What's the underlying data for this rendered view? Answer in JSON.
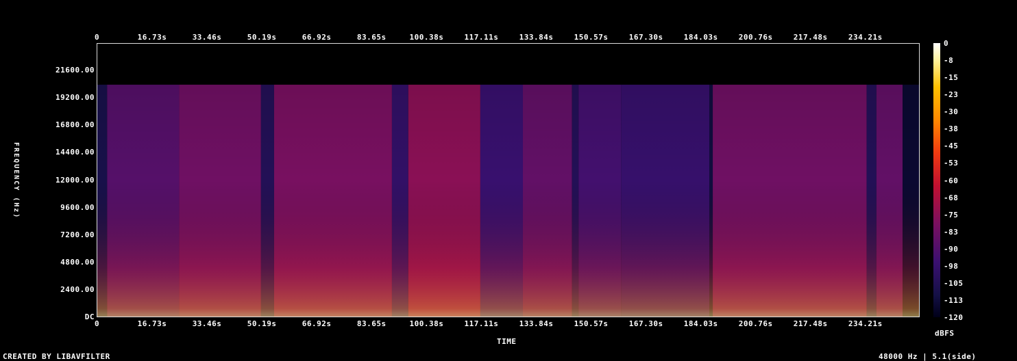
{
  "chart_data": {
    "type": "heatmap",
    "title": "",
    "xlabel": "TIME",
    "ylabel": "FREQUENCY (Hz)",
    "x_ticks": [
      "0",
      "16.73s",
      "33.46s",
      "50.19s",
      "66.92s",
      "83.65s",
      "100.38s",
      "117.11s",
      "133.84s",
      "150.57s",
      "167.30s",
      "184.03s",
      "200.76s",
      "217.48s",
      "234.21s"
    ],
    "x_tick_values": [
      0,
      16.73,
      33.46,
      50.19,
      66.92,
      83.65,
      100.38,
      117.11,
      133.84,
      150.57,
      167.3,
      184.03,
      200.76,
      217.48,
      234.21
    ],
    "xlim": [
      0,
      251
    ],
    "y_ticks": [
      "DC",
      "2400.00",
      "4800.00",
      "7200.00",
      "9600.00",
      "12000.00",
      "14400.00",
      "16800.00",
      "19200.00",
      "21600.00"
    ],
    "y_tick_values": [
      0,
      2400,
      4800,
      7200,
      9600,
      12000,
      14400,
      16800,
      19200,
      21600
    ],
    "ylim": [
      0,
      24000
    ],
    "colorbar": {
      "label": "dBFS",
      "ticks": [
        "0",
        "-8",
        "-15",
        "-23",
        "-30",
        "-38",
        "-45",
        "-53",
        "-60",
        "-68",
        "-75",
        "-83",
        "-90",
        "-98",
        "-105",
        "-113",
        "-120"
      ],
      "range": [
        -120,
        0
      ]
    },
    "content_cutoff_hz": 20400,
    "segments": [
      {
        "t0": 0,
        "t1": 3,
        "level": -100
      },
      {
        "t0": 3,
        "t1": 25,
        "level": -78
      },
      {
        "t0": 25,
        "t1": 50,
        "level": -72
      },
      {
        "t0": 50,
        "t1": 54,
        "level": -95
      },
      {
        "t0": 54,
        "t1": 90,
        "level": -70
      },
      {
        "t0": 90,
        "t1": 95,
        "level": -88
      },
      {
        "t0": 95,
        "t1": 117,
        "level": -66
      },
      {
        "t0": 117,
        "t1": 130,
        "level": -85
      },
      {
        "t0": 130,
        "t1": 145,
        "level": -75
      },
      {
        "t0": 145,
        "t1": 147,
        "level": -95
      },
      {
        "t0": 147,
        "t1": 160,
        "level": -82
      },
      {
        "t0": 160,
        "t1": 187,
        "level": -86
      },
      {
        "t0": 187,
        "t1": 188,
        "level": -105
      },
      {
        "t0": 188,
        "t1": 235,
        "level": -72
      },
      {
        "t0": 235,
        "t1": 238,
        "level": -95
      },
      {
        "t0": 238,
        "t1": 246,
        "level": -75
      },
      {
        "t0": 246,
        "t1": 251,
        "level": -110
      }
    ]
  },
  "footer": {
    "left": "CREATED BY LIBAVFILTER",
    "right": "48000 Hz | 5.1(side)"
  }
}
